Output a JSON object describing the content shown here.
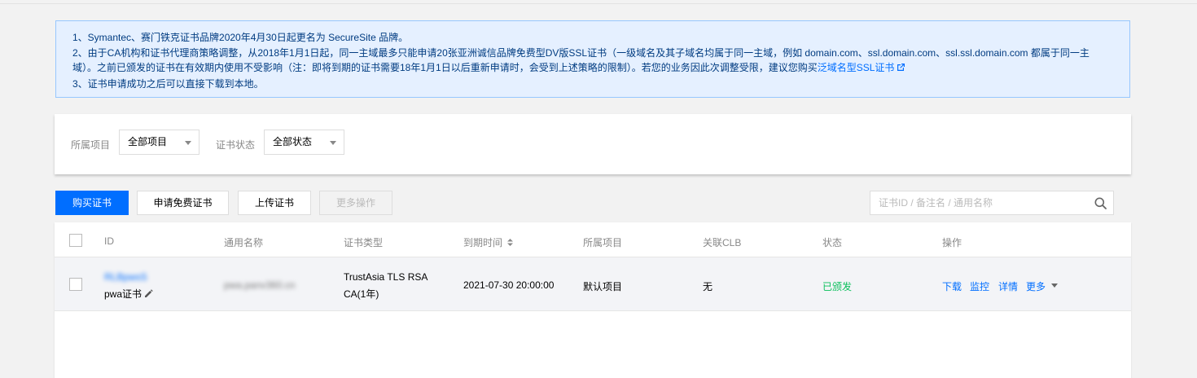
{
  "notice": {
    "line1": "1、Symantec、赛门铁克证书品牌2020年4月30日起更名为 SecureSite 品牌。",
    "line2": "2、由于CA机构和证书代理商策略调整，从2018年1月1日起，同一主域最多只能申请20张亚洲诚信品牌免费型DV版SSL证书（一级域名及其子域名均属于同一主域，例如 domain.com、ssl.domain.com、ssl.ssl.domain.com 都属于同一主",
    "line3_text": "域）。之前已颁发的证书在有效期内使用不受影响（注：即将到期的证书需要18年1月1日以后重新申请时，会受到上述策略的限制）。若您的业务因此次调整受限，建议您购买",
    "line3_link": "泛域名型SSL证书",
    "line4": "3、证书申请成功之后可以直接下载到本地。"
  },
  "filters": {
    "project_label": "所属项目",
    "project_value": "全部项目",
    "status_label": "证书状态",
    "status_value": "全部状态"
  },
  "toolbar": {
    "buy_label": "购买证书",
    "apply_free_label": "申请免费证书",
    "upload_label": "上传证书",
    "more_actions_label": "更多操作",
    "search_placeholder": "证书ID / 备注名 / 通用名称"
  },
  "table": {
    "headers": {
      "id": "ID",
      "common_name": "通用名称",
      "cert_type": "证书类型",
      "expiry": "到期时间",
      "project": "所属项目",
      "clb": "关联CLB",
      "status": "状态",
      "actions": "操作"
    },
    "rows": [
      {
        "id": "RLBpwsS",
        "remark": "pwa证书",
        "common_name": "pwa.panv360.cn",
        "cert_type_line1": "TrustAsia TLS RSA",
        "cert_type_line2": "CA(1年)",
        "expiry": "2021-07-30 20:00:00",
        "project": "默认项目",
        "clb": "无",
        "status": "已颁发",
        "actions": {
          "download": "下载",
          "monitor": "监控",
          "details": "详情",
          "more": "更多"
        }
      }
    ]
  },
  "colors": {
    "primary": "#006eff",
    "notice_bg": "#e5f0ff",
    "notice_border": "#97c7ff",
    "status_success": "#0abf5b"
  }
}
